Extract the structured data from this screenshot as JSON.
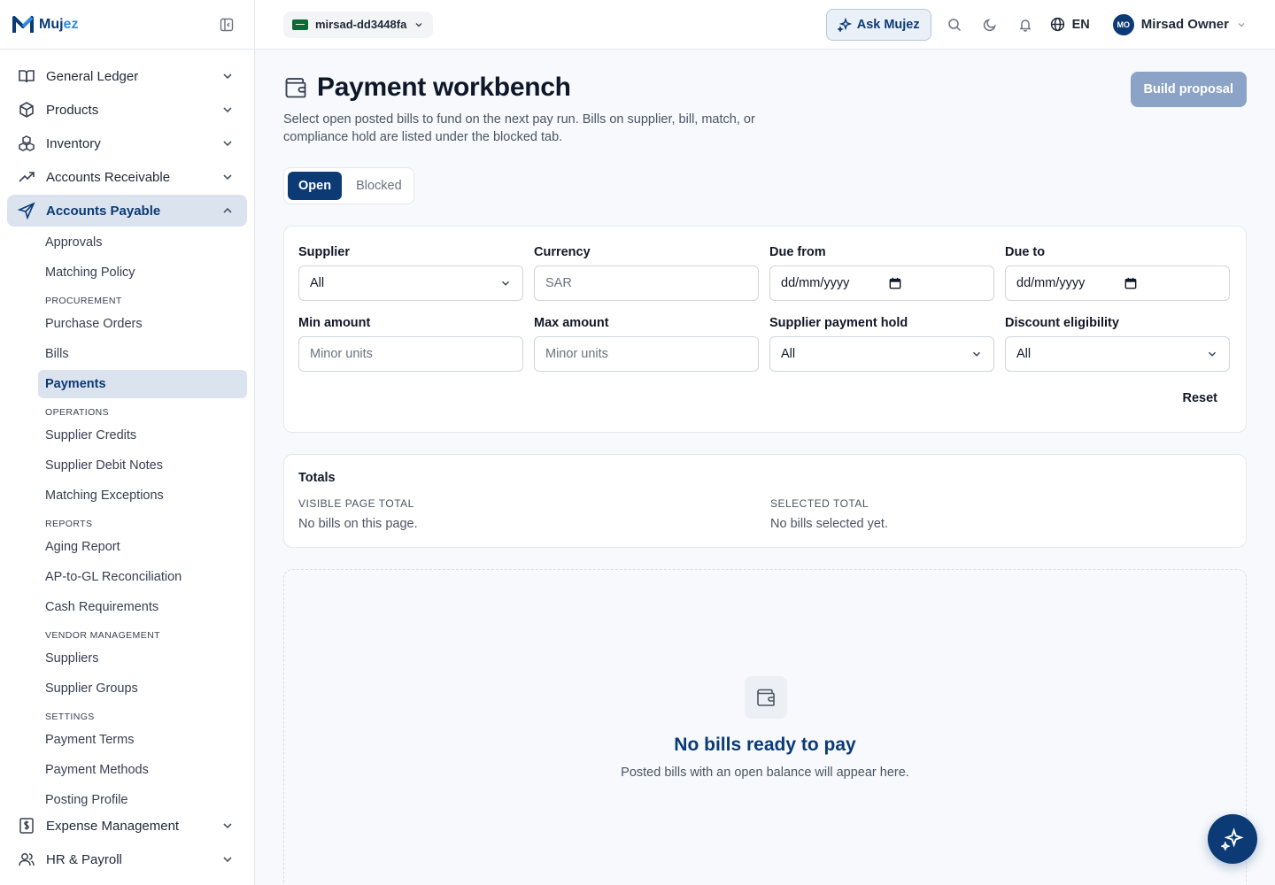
{
  "brand": {
    "name_a": "Muj",
    "name_b": "ez"
  },
  "sidebar": {
    "items_top": [
      {
        "label": "General Ledger",
        "icon": "book-open-icon"
      },
      {
        "label": "Products",
        "icon": "box-icon"
      },
      {
        "label": "Inventory",
        "icon": "boxes-icon"
      },
      {
        "label": "Accounts Receivable",
        "icon": "trending-up-icon"
      },
      {
        "label": "Accounts Payable",
        "icon": "send-icon"
      }
    ],
    "ap_sub": {
      "approvals": "Approvals",
      "matching_policy": "Matching Policy",
      "procurement": "PROCUREMENT",
      "purchase_orders": "Purchase Orders",
      "bills": "Bills",
      "payments": "Payments",
      "operations": "OPERATIONS",
      "supplier_credits": "Supplier Credits",
      "supplier_debit_notes": "Supplier Debit Notes",
      "matching_exceptions": "Matching Exceptions",
      "reports": "REPORTS",
      "aging_report": "Aging Report",
      "ap_gl_recon": "AP-to-GL Reconciliation",
      "cash_requirements": "Cash Requirements",
      "vendor_management": "VENDOR MANAGEMENT",
      "suppliers": "Suppliers",
      "supplier_groups": "Supplier Groups",
      "settings": "SETTINGS",
      "payment_terms": "Payment Terms",
      "payment_methods": "Payment Methods",
      "posting_profile": "Posting Profile"
    },
    "items_bottom": [
      {
        "label": "Expense Management",
        "icon": "receipt-icon"
      },
      {
        "label": "HR & Payroll",
        "icon": "users-icon"
      }
    ]
  },
  "topbar": {
    "org": "mirsad-dd3448fa",
    "ask": "Ask Mujez",
    "lang": "EN",
    "user_initials": "MO",
    "user_name": "Mirsad Owner"
  },
  "page": {
    "title": "Payment workbench",
    "description": "Select open posted bills to fund on the next pay run. Bills on supplier, bill, match, or compliance hold are listed under the blocked tab.",
    "build_button": "Build proposal",
    "tabs": {
      "open": "Open",
      "blocked": "Blocked"
    }
  },
  "filters": {
    "supplier": {
      "label": "Supplier",
      "value": "All"
    },
    "currency": {
      "label": "Currency",
      "placeholder": "SAR"
    },
    "due_from": {
      "label": "Due from",
      "value": "dd/mm/yyyy"
    },
    "due_to": {
      "label": "Due to",
      "value": "dd/mm/yyyy"
    },
    "min_amount": {
      "label": "Min amount",
      "placeholder": "Minor units"
    },
    "max_amount": {
      "label": "Max amount",
      "placeholder": "Minor units"
    },
    "hold": {
      "label": "Supplier payment hold",
      "value": "All"
    },
    "discount": {
      "label": "Discount eligibility",
      "value": "All"
    },
    "reset": "Reset"
  },
  "totals": {
    "title": "Totals",
    "visible_label": "VISIBLE PAGE TOTAL",
    "visible_value": "No bills on this page.",
    "selected_label": "SELECTED TOTAL",
    "selected_value": "No bills selected yet."
  },
  "empty": {
    "title": "No bills ready to pay",
    "subtitle": "Posted bills with an open balance will appear here."
  },
  "colors": {
    "primary": "#0b3a75",
    "accent": "#2f8ae0",
    "disabled_button": "#8ba3c6"
  }
}
